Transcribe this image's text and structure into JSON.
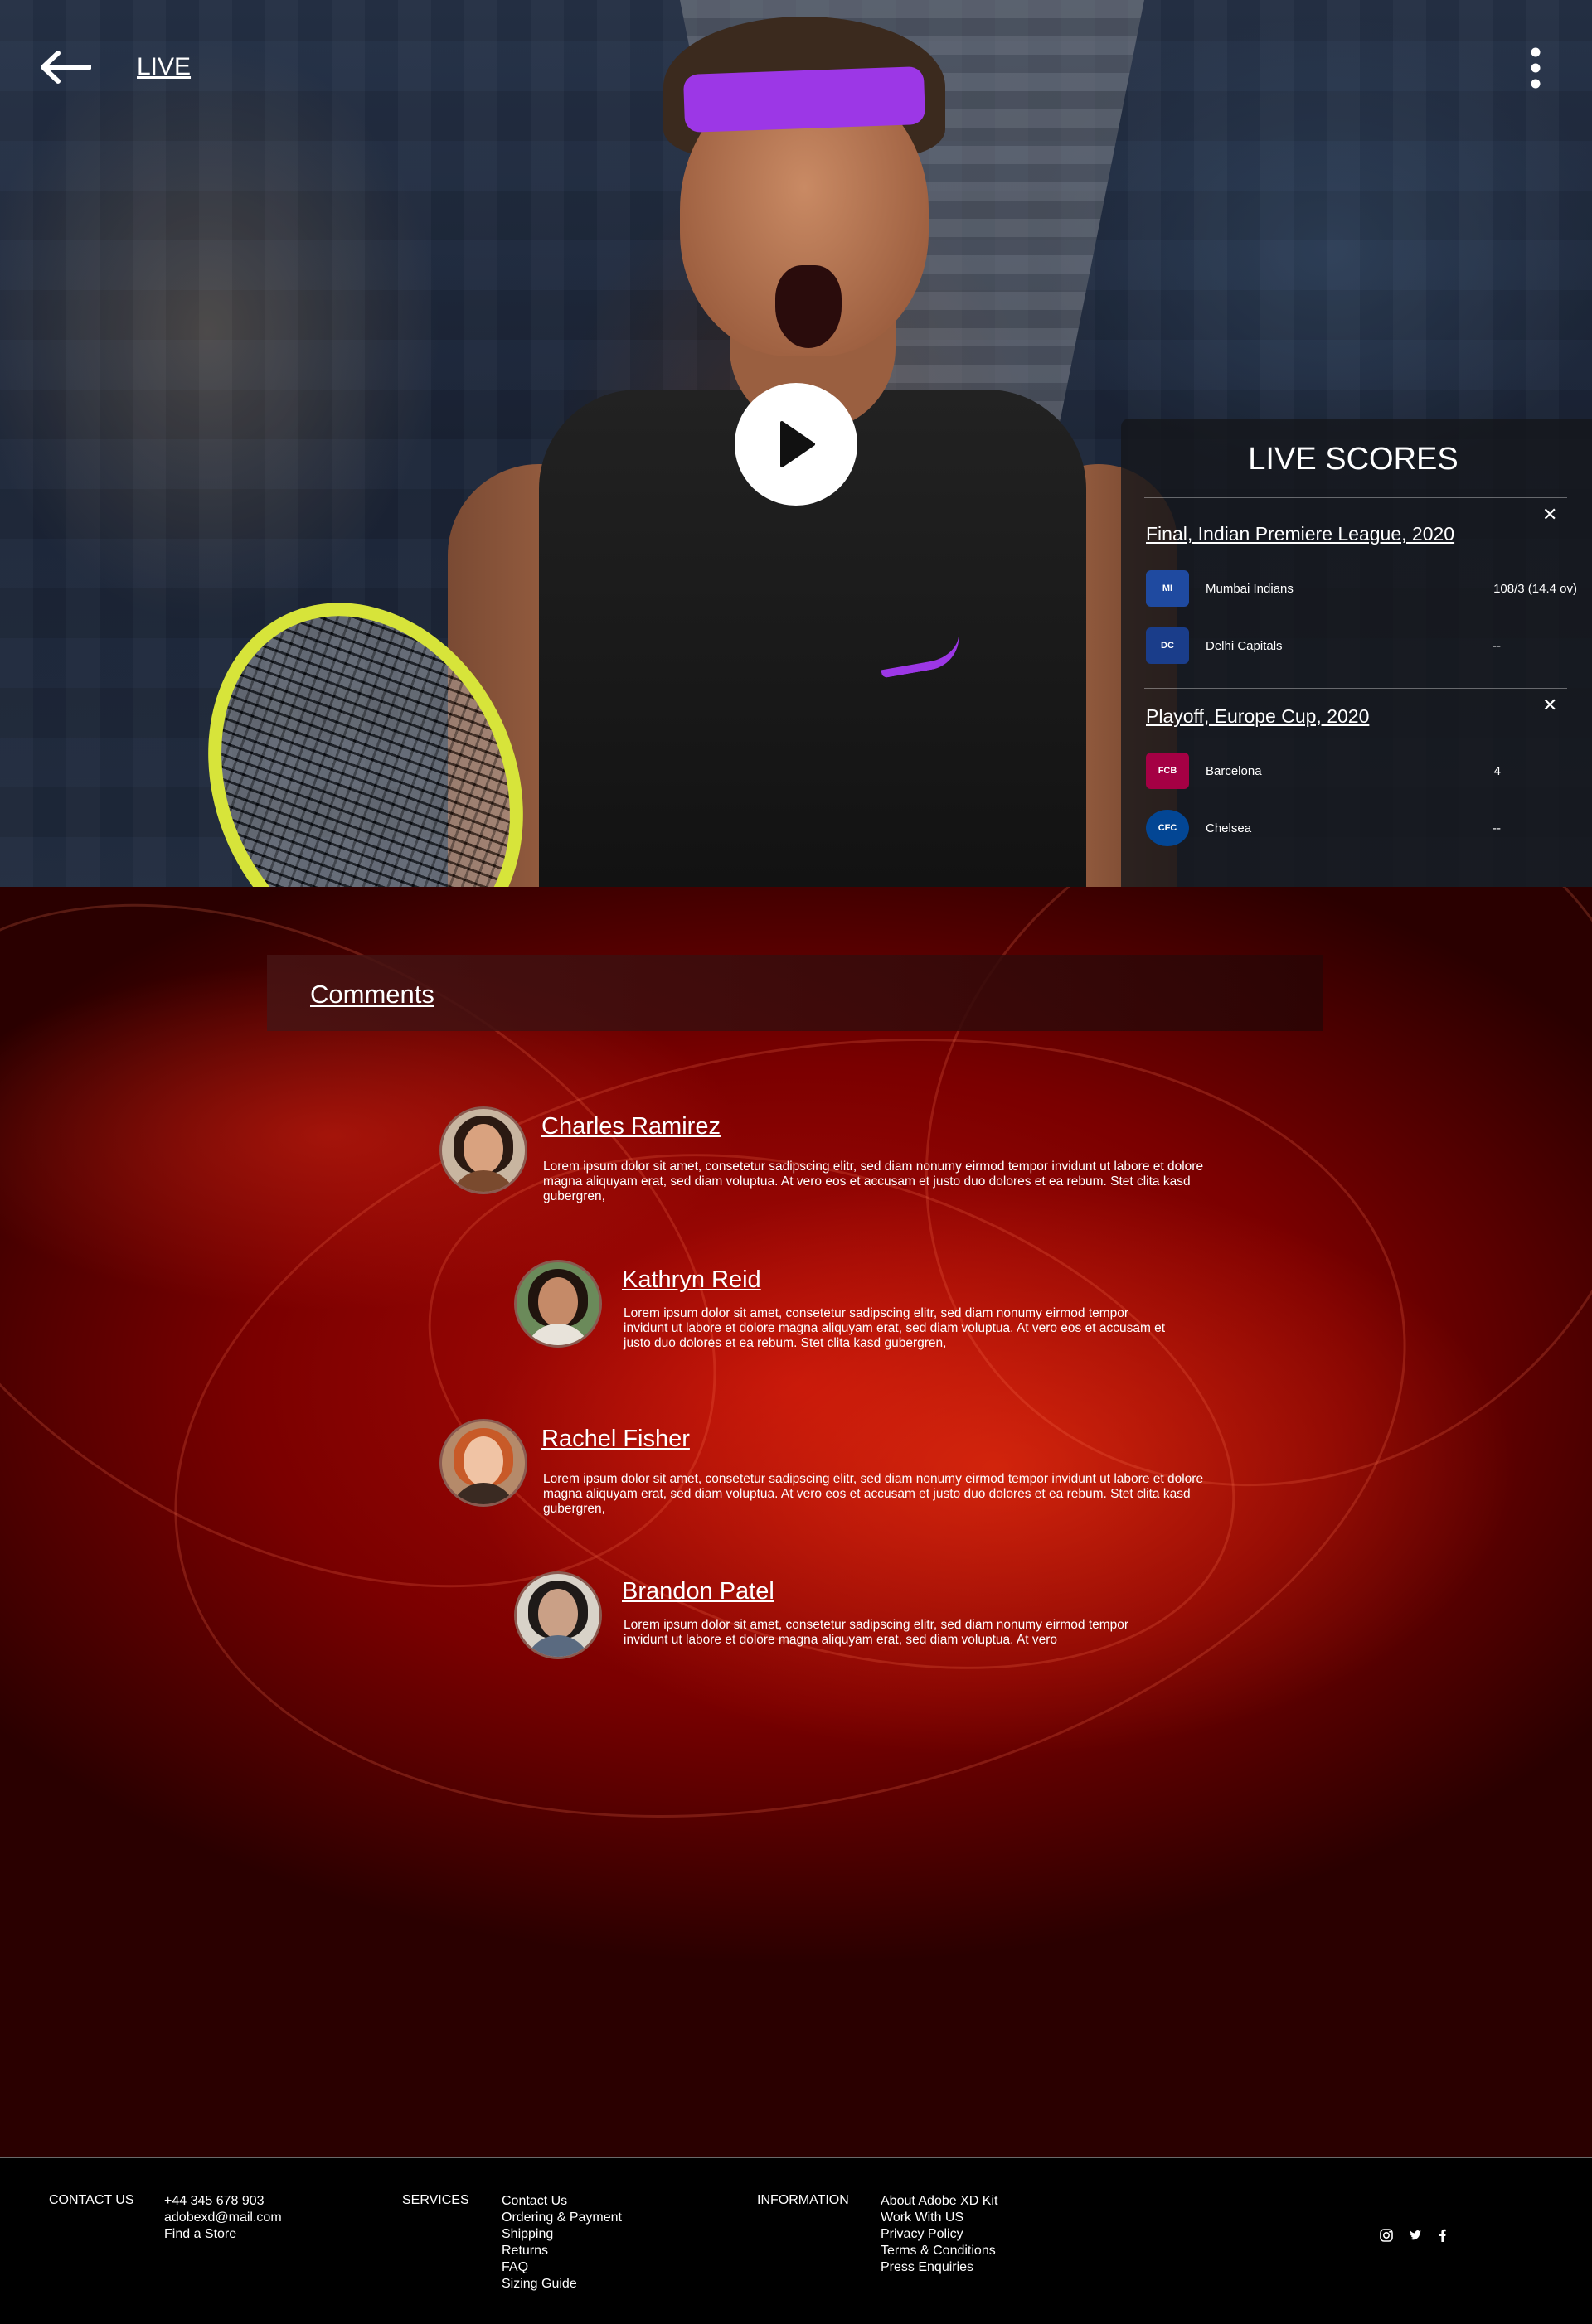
{
  "header": {
    "live_label": "LIVE",
    "back_icon": "arrow-left-icon",
    "menu_icon": "more-vertical-icon"
  },
  "video": {
    "play_icon": "play-icon"
  },
  "live_scores": {
    "title": "LIVE SCORES",
    "matches": [
      {
        "title": "Final, Indian Premiere League, 2020",
        "teams": [
          {
            "name": "Mumbai Indians",
            "score": "108/3 (14.4 ov)",
            "logo_text": "MI",
            "logo_color": "#1f4aa0"
          },
          {
            "name": "Delhi Capitals",
            "score": "--",
            "logo_text": "DC",
            "logo_color": "#1a3d8a"
          }
        ]
      },
      {
        "title": "Playoff, Europe Cup, 2020",
        "teams": [
          {
            "name": "Barcelona",
            "score": "4",
            "logo_text": "FCB",
            "logo_color": "#a50044"
          },
          {
            "name": "Chelsea",
            "score": "--",
            "logo_text": "CFC",
            "logo_color": "#034694"
          }
        ]
      }
    ]
  },
  "comments": {
    "title": "Comments",
    "items": [
      {
        "name": "Charles Ramirez",
        "text": "Lorem ipsum dolor sit amet, consetetur sadipscing elitr, sed diam nonumy eirmod tempor invidunt ut labore et dolore magna aliquyam erat, sed diam voluptua. At vero eos et accusam et justo duo dolores et ea rebum. Stet clita kasd gubergren,"
      },
      {
        "name": "Kathryn Reid",
        "text": "Lorem ipsum dolor sit amet, consetetur sadipscing elitr, sed diam nonumy eirmod tempor invidunt ut labore et dolore magna aliquyam erat, sed diam voluptua. At vero eos et accusam et justo duo dolores et ea rebum. Stet clita kasd gubergren,"
      },
      {
        "name": "Rachel Fisher",
        "text": "Lorem ipsum dolor sit amet, consetetur sadipscing elitr, sed diam nonumy eirmod tempor invidunt ut labore et dolore magna aliquyam erat, sed diam voluptua. At vero eos et accusam et justo duo dolores et ea rebum. Stet clita kasd gubergren,"
      },
      {
        "name": "Brandon Patel",
        "text": "Lorem ipsum dolor sit amet, consetetur sadipscing elitr, sed diam nonumy eirmod tempor invidunt ut labore et dolore magna aliquyam erat, sed diam voluptua. At vero"
      }
    ]
  },
  "footer": {
    "contact": {
      "heading": "CONTACT US",
      "phone": "+44 345 678 903",
      "email": "adobexd@mail.com",
      "store": "Find a Store"
    },
    "services": {
      "heading": "SERVICES",
      "links": [
        "Contact Us",
        "Ordering & Payment",
        "Shipping",
        "Returns",
        "FAQ",
        "Sizing Guide"
      ]
    },
    "information": {
      "heading": "INFORMATION",
      "links": [
        "About Adobe XD Kit",
        "Work With US",
        "Privacy Policy",
        "Terms & Conditions",
        "Press Enquiries"
      ]
    },
    "social_icons": [
      "instagram-icon",
      "twitter-icon",
      "facebook-icon"
    ]
  }
}
